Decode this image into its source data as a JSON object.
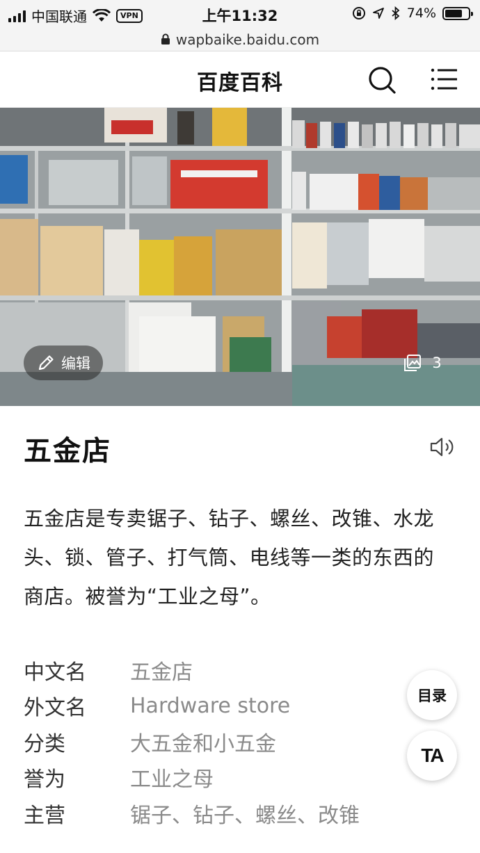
{
  "status_bar": {
    "carrier": "中国联通",
    "vpn": "VPN",
    "time": "上午11:32",
    "battery_percent": "74%",
    "battery_level": 0.74
  },
  "browser": {
    "url": "wapbaike.baidu.com"
  },
  "header": {
    "title": "百度百科"
  },
  "hero": {
    "edit_label": "编辑",
    "image_count": "3"
  },
  "article": {
    "title": "五金店",
    "summary": "五金店是专卖锯子、钻子、螺丝、改锥、水龙头、锁、管子、打气筒、电线等一类的东西的商店。被誉为“工业之母”。"
  },
  "infobox": [
    {
      "key": "中文名",
      "value": "五金店"
    },
    {
      "key": "外文名",
      "value": "Hardware store"
    },
    {
      "key": "分类",
      "value": "大五金和小五金"
    },
    {
      "key": "誉为",
      "value": "工业之母"
    },
    {
      "key": "主营",
      "value": "锯子、钻子、螺丝、改锥"
    }
  ],
  "floating": {
    "toc_label": "目录",
    "font_label": "TA"
  },
  "icons": {
    "search": "search-icon",
    "menu": "menu-icon",
    "edit": "pencil-icon",
    "gallery": "gallery-icon",
    "speaker": "speaker-icon",
    "lock": "lock-icon"
  }
}
